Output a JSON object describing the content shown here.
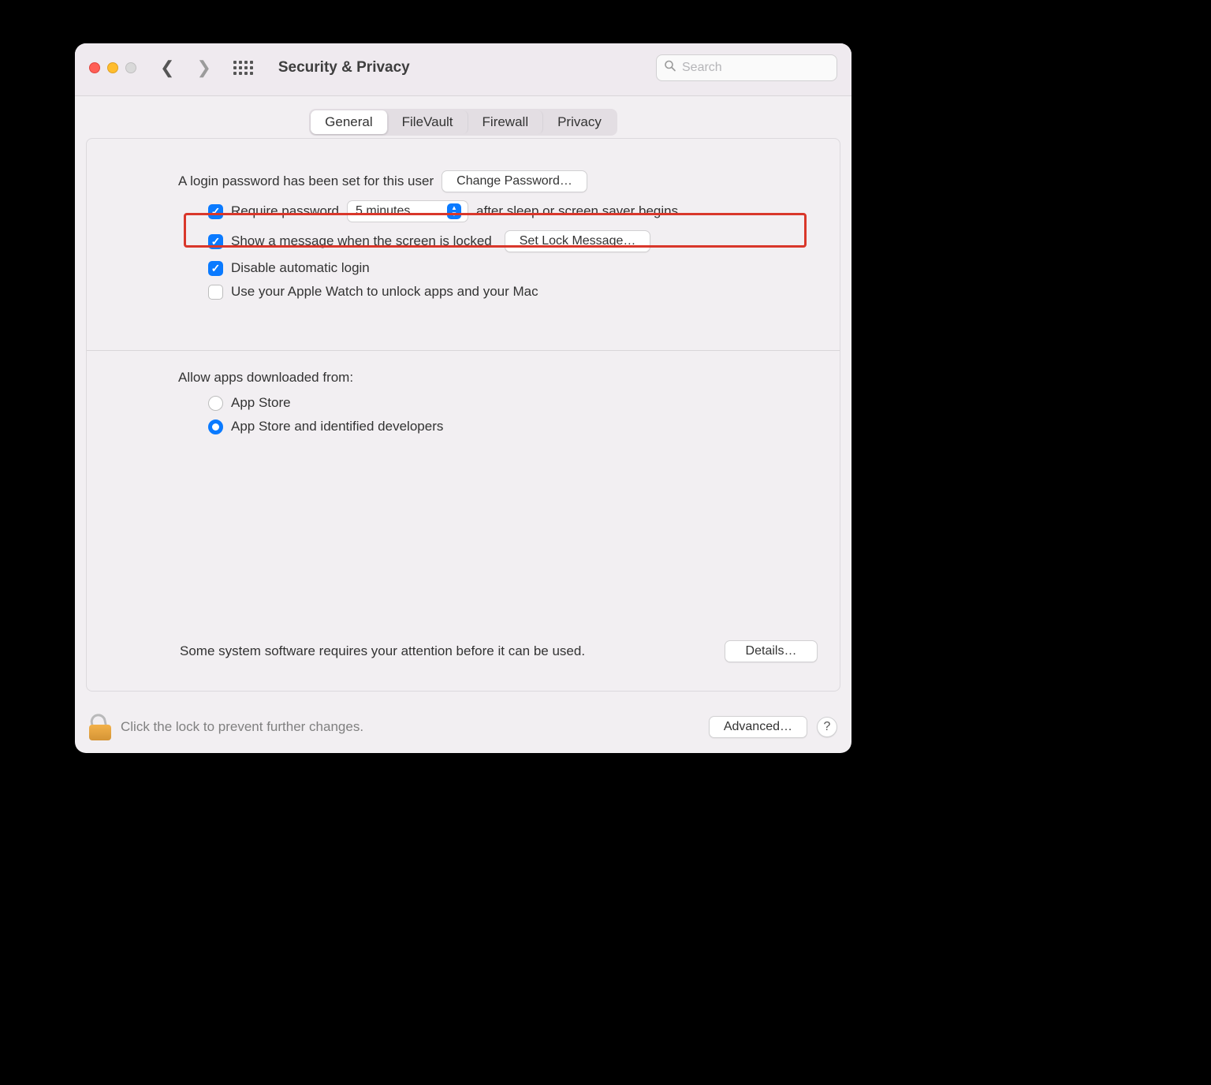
{
  "toolbar": {
    "title": "Security & Privacy",
    "search_placeholder": "Search"
  },
  "tabs": {
    "general": "General",
    "filevault": "FileVault",
    "firewall": "Firewall",
    "privacy": "Privacy"
  },
  "general": {
    "login_text": "A login password has been set for this user",
    "change_password_btn": "Change Password…",
    "require_password_label": "Require password",
    "require_password_delay": "5 minutes",
    "require_password_suffix": "after sleep or screen saver begins",
    "show_message_label": "Show a message when the screen is locked",
    "set_lock_message_btn": "Set Lock Message…",
    "disable_auto_login_label": "Disable automatic login",
    "apple_watch_label": "Use your Apple Watch to unlock apps and your Mac"
  },
  "gatekeeper": {
    "section_label": "Allow apps downloaded from:",
    "option_appstore": "App Store",
    "option_identified": "App Store and identified developers"
  },
  "system_software": {
    "text": "Some system software requires your attention before it can be used.",
    "details_btn": "Details…"
  },
  "footer": {
    "lock_text": "Click the lock to prevent further changes.",
    "advanced_btn": "Advanced…",
    "help_tooltip": "?"
  }
}
